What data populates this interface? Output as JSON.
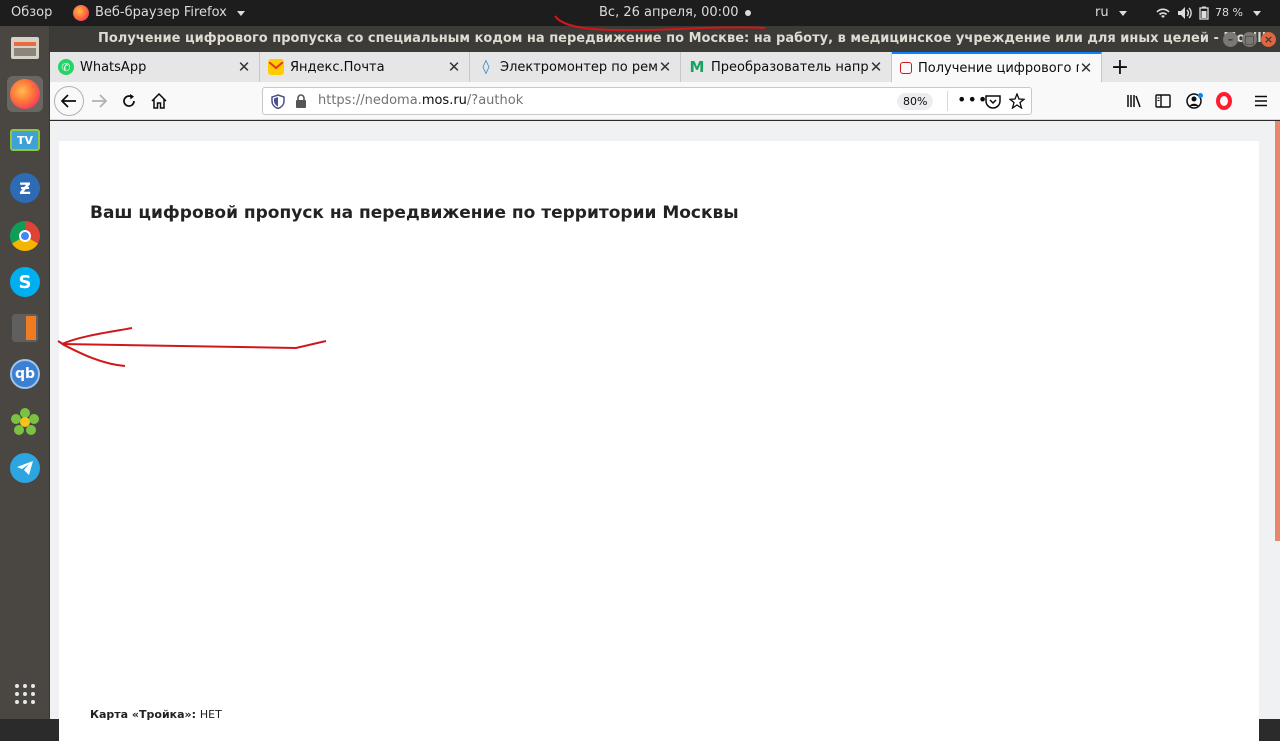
{
  "top_panel": {
    "activities": "Обзор",
    "app_menu": "Веб-браузер Firefox",
    "clock": "Вс, 26 апреля, 00:00",
    "lang": "ru",
    "battery": "78 %"
  },
  "window": {
    "title": "Получение цифрового пропуска со специальным кодом на передвижение по Москве: на работу, в медицинское учреждение или для иных целей - Mozilla Firefox"
  },
  "launcher": {
    "items": [
      "files-icon",
      "firefox-icon",
      "tv-icon",
      "bitwarden-icon",
      "chrome-icon",
      "skype-icon",
      "calculator-icon",
      "qbittorrent-icon",
      "icq-icon",
      "telegram-icon",
      "app-grid-icon"
    ]
  },
  "tabs": [
    {
      "label": "WhatsApp"
    },
    {
      "label": "Яндекс.Почта"
    },
    {
      "label": "Электромонтер по ремонту"
    },
    {
      "label": "Преобразователь напряжения"
    },
    {
      "label": "Получение цифрового пропуска",
      "selected": true
    }
  ],
  "navbar": {
    "url_prefix": "https://nedoma.",
    "url_domain": "mos.ru",
    "url_suffix": "/?authok",
    "zoom": "80%"
  },
  "page": {
    "heading": "Ваш цифровой пропуск на передвижение по территории Москвы",
    "troika_label": "Карта «Тройка»:",
    "troika_value": "НЕТ"
  },
  "colors": {
    "accent": "#0a84ff",
    "annotation": "#d0181b"
  }
}
